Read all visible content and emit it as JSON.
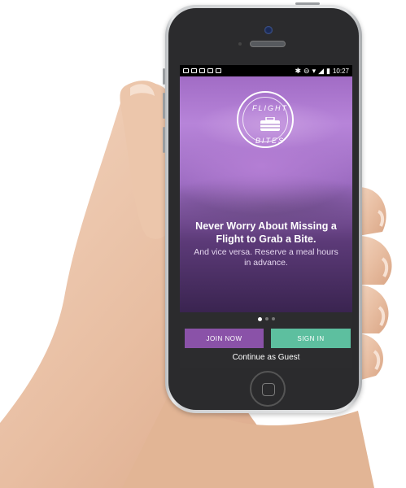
{
  "status_bar": {
    "time": "10:27"
  },
  "logo": {
    "top_text": "FLIGHT",
    "bottom_text": "BITES",
    "icon": "lunchbox-icon"
  },
  "hero": {
    "headline_line1": "Never Worry About Missing a",
    "headline_line2": "Flight to Grab a Bite.",
    "subtext_line1": "And vice versa. Reserve a meal hours",
    "subtext_line2": "in advance."
  },
  "pager": {
    "count": 3,
    "active": 0
  },
  "actions": {
    "join_label": "JOIN NOW",
    "signin_label": "SIGN IN",
    "guest_label": "Continue as Guest"
  },
  "colors": {
    "join": "#8a52a8",
    "signin": "#5dbf9f",
    "hero_tint": "#a16cc5"
  }
}
